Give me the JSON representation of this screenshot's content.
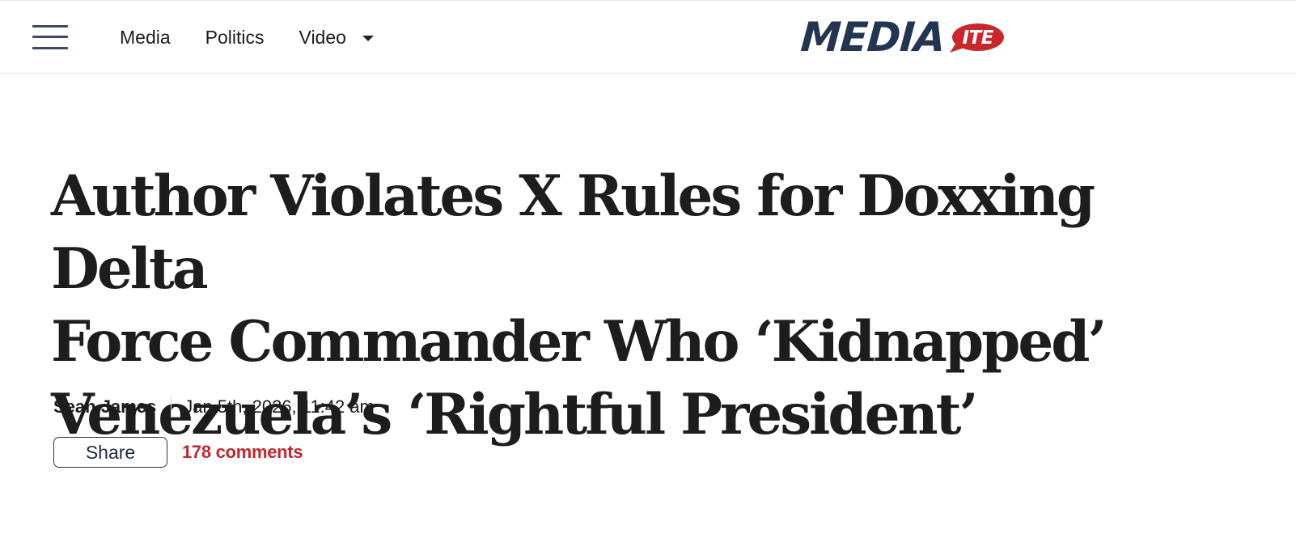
{
  "header": {
    "nav": [
      {
        "label": "Media"
      },
      {
        "label": "Politics"
      },
      {
        "label": "Video"
      }
    ],
    "logo": {
      "main": "MEDIA",
      "bubble": "ITE",
      "colors": {
        "main": "#243552",
        "bubble": "#c9262e"
      }
    },
    "icons": {
      "menu": "hamburger-menu-icon",
      "dropdown": "caret-down-icon"
    }
  },
  "article": {
    "headline_lines": [
      "Author Violates X Rules for Doxxing Delta",
      "Force Commander Who ‘Kidnapped’",
      "Venezuela’s ‘Rightful President’"
    ],
    "author": "Sean James",
    "date": "Jan 5th, 2026, 11:42 am",
    "share_label": "Share",
    "comments_label": "178 comments"
  },
  "colors": {
    "accent": "#c1272d",
    "text": "#1c1c1c",
    "logo_navy": "#243552"
  }
}
